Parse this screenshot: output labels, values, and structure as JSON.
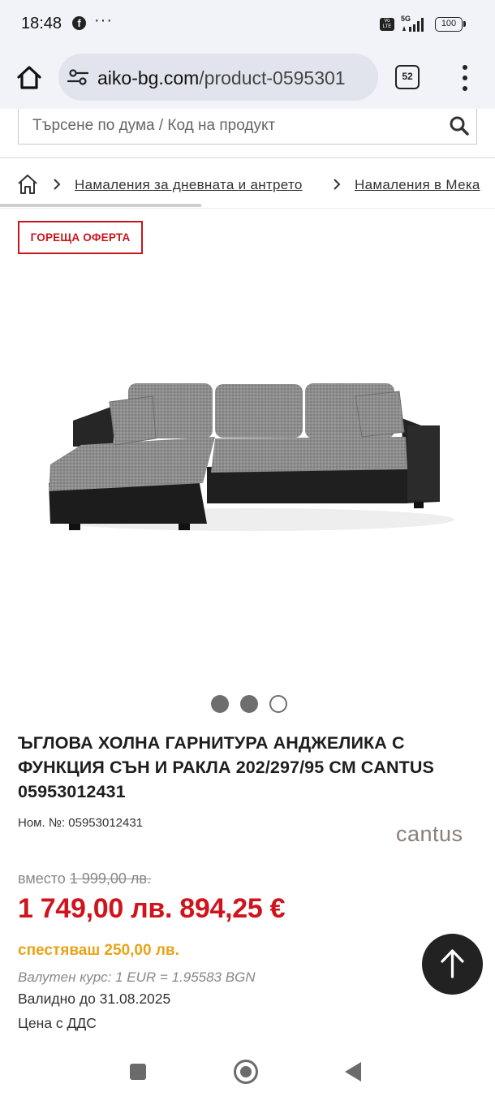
{
  "status_bar": {
    "time": "18:48",
    "dots": "···",
    "network": "5G",
    "battery": "100"
  },
  "browser": {
    "url_domain": "aiko-bg.com",
    "url_path": "/product-0595301",
    "tab_count": "52"
  },
  "search": {
    "placeholder": "Търсене по дума / Код на продукт"
  },
  "breadcrumb": {
    "items": [
      "Намаления за дневната и антрето",
      "Намаления в Мека"
    ]
  },
  "badge": {
    "label": "ГОРЕЩА ОФЕРТА",
    "color": "#c9151e"
  },
  "gallery": {
    "image_count": 3,
    "active_index": 0
  },
  "product": {
    "title": "ЪГЛОВА ХОЛНА ГАРНИТУРА АНДЖЕЛИКА С ФУНКЦИЯ СЪН И РАКЛА 202/297/95 СМ CANTUS 05953012431",
    "item_no_label": "Ном. №:",
    "item_no": "05953012431",
    "brand": "cantus"
  },
  "pricing": {
    "old_label": "вместо",
    "old_price": "1 999,00 лв.",
    "new_price": "1 749,00 лв. 894,25 €",
    "savings": "спестяваш 250,00 лв.",
    "exchange_rate": "Валутен курс: 1 EUR = 1.95583 BGN",
    "valid_until": "Валидно до 31.08.2025",
    "vat_note": "Цена с ДДС",
    "price_color": "#d0141d",
    "savings_color": "#e8a317"
  },
  "icons": {
    "home": "home-icon",
    "search": "search-icon",
    "scroll_top": "arrow-up-icon",
    "menu": "more-vert-icon"
  }
}
